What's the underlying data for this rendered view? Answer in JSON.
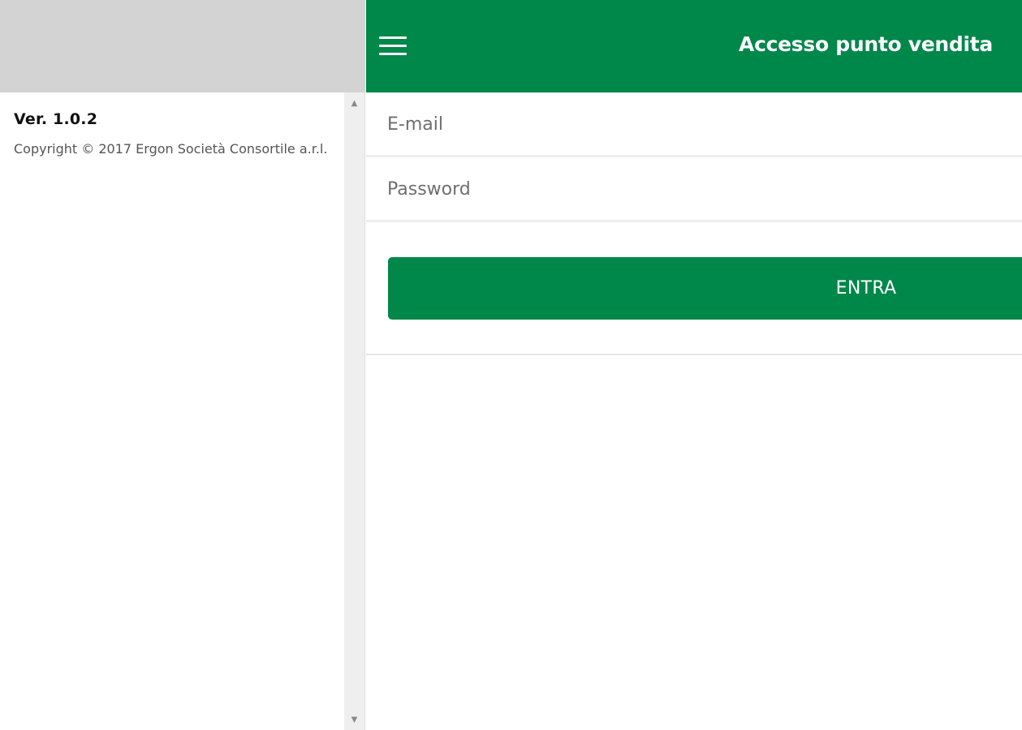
{
  "drawer": {
    "version": "Ver. 1.0.2",
    "copyright": "Copyright © 2017 Ergon Società Consortile a.r.l."
  },
  "header": {
    "title": "Accesso punto vendita",
    "menu_icon": "hamburger-menu-icon",
    "background_color": "#00874a"
  },
  "login_form": {
    "email_placeholder": "E-mail",
    "email_value": "",
    "password_placeholder": "Password",
    "password_value": "",
    "submit_label": "ENTRA"
  },
  "colors": {
    "accent": "#00874a",
    "drawer_header": "#d3d3d3"
  }
}
